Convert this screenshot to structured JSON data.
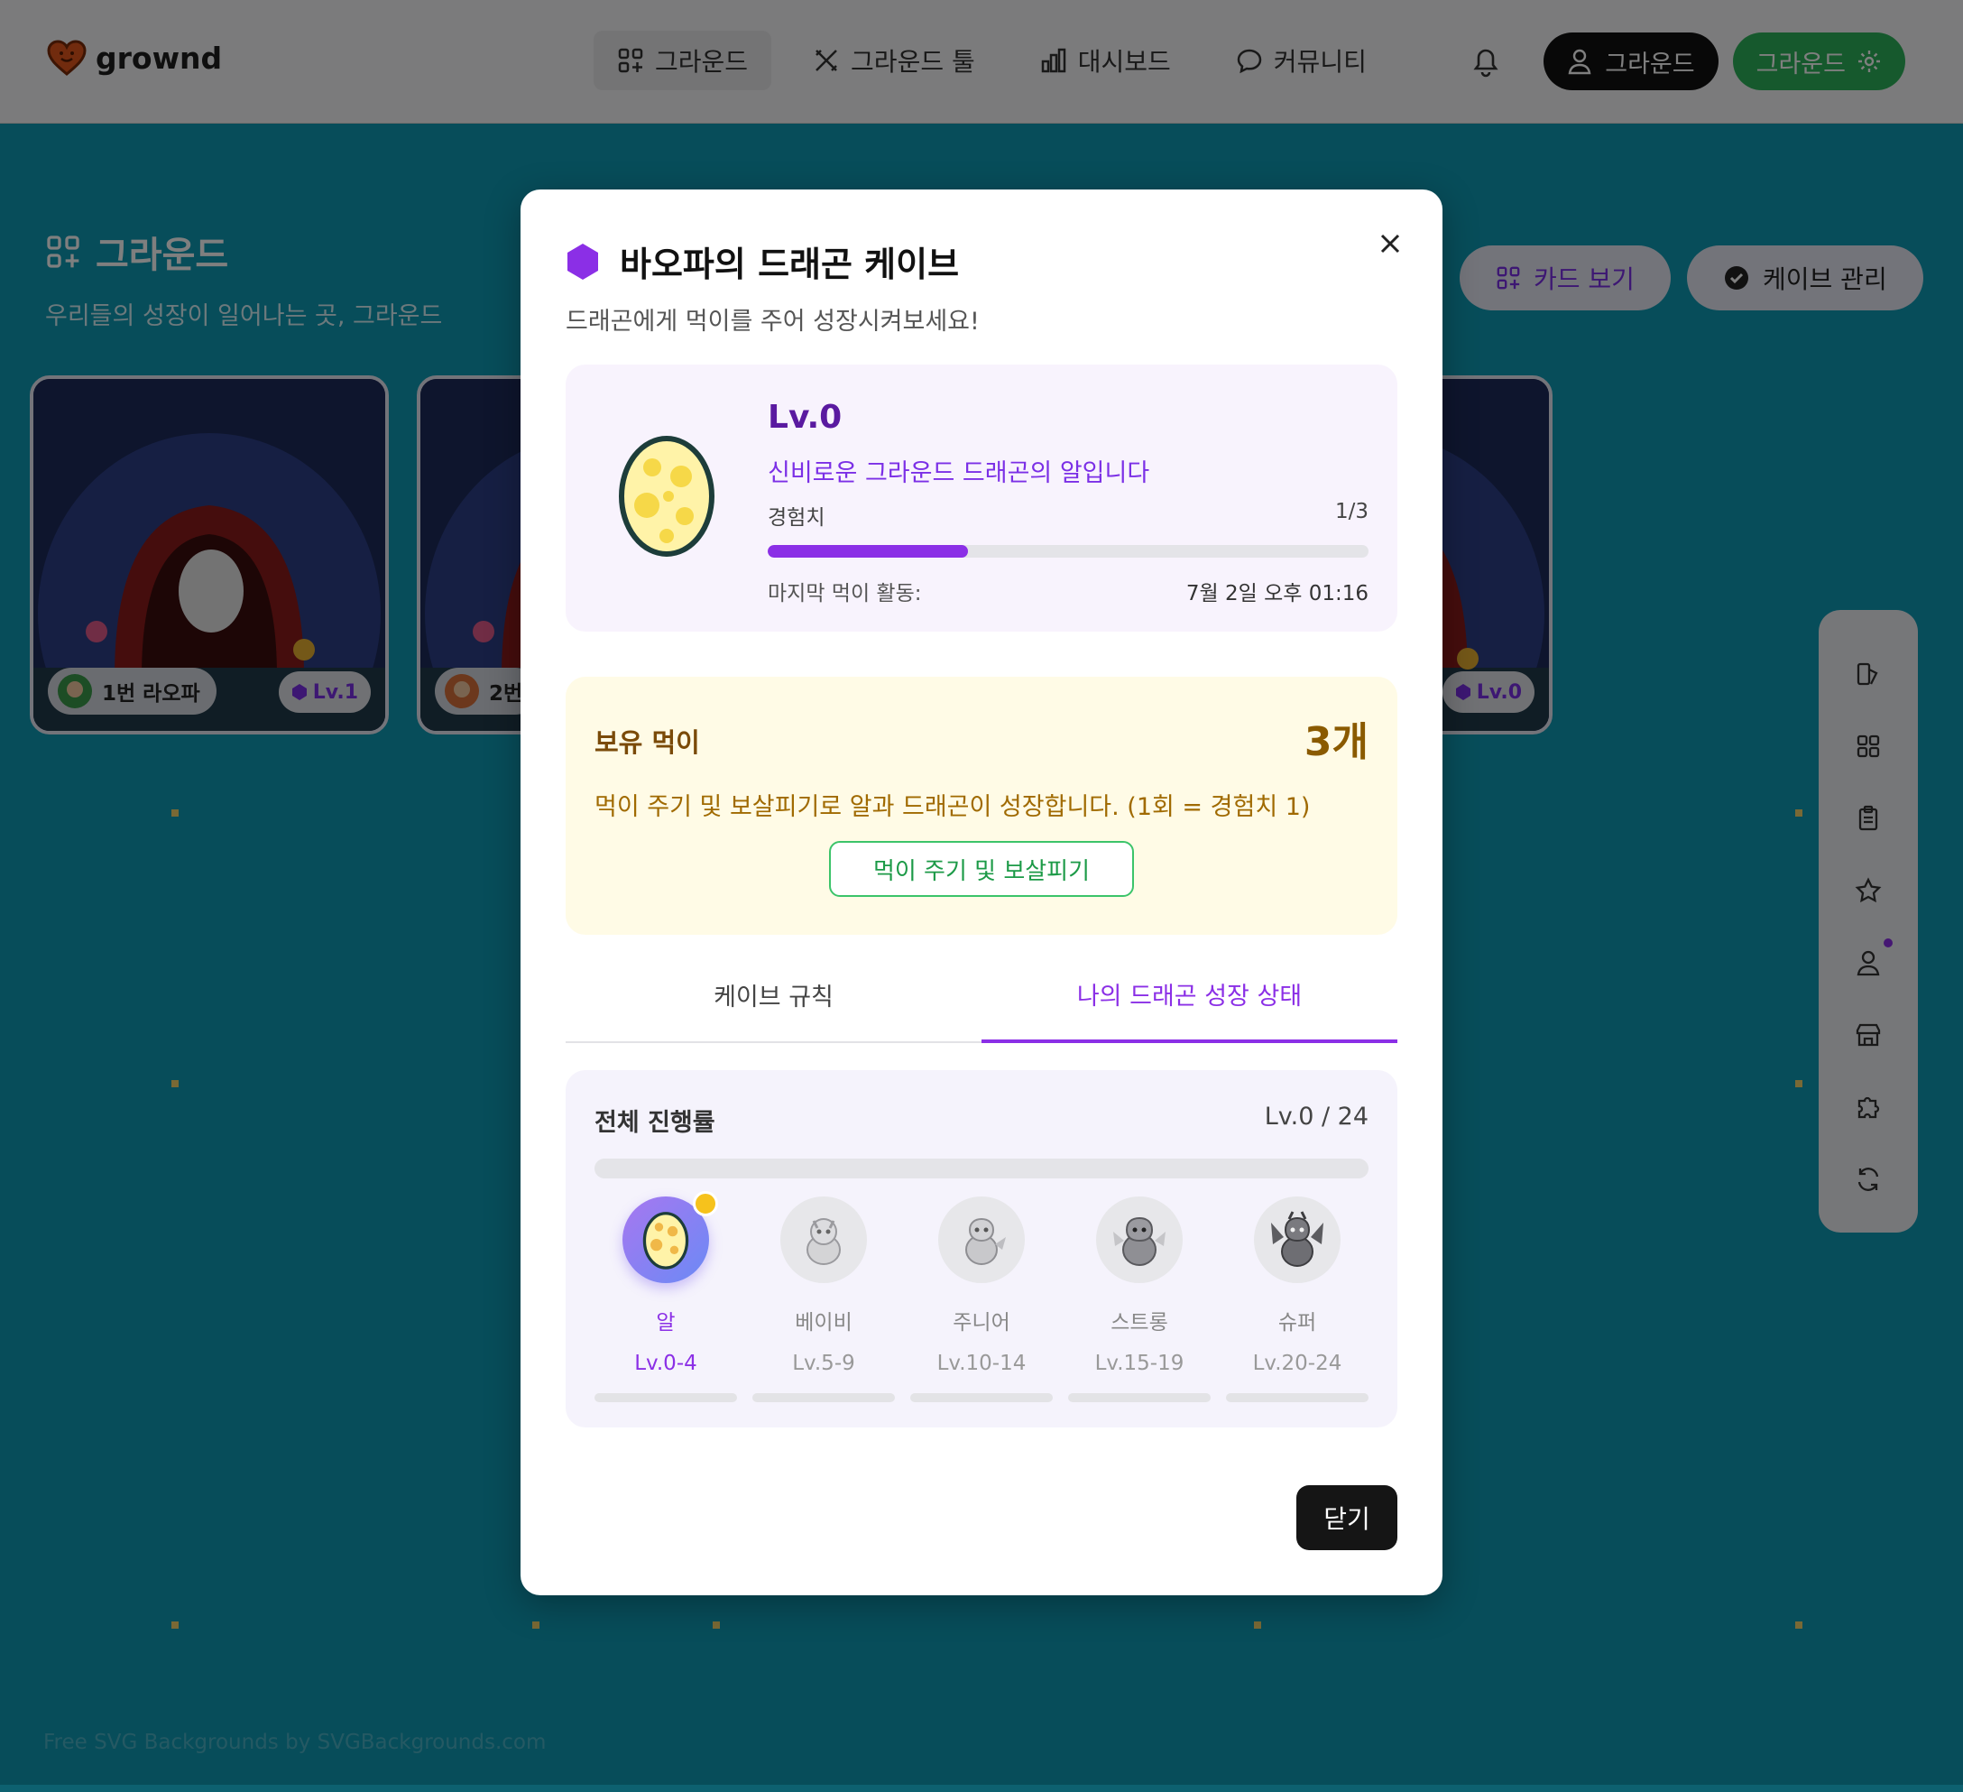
{
  "header": {
    "logo_text": "grownd",
    "nav": [
      {
        "label": "그라운드",
        "icon": "grid-plus-icon",
        "active": true
      },
      {
        "label": "그라운드 툴",
        "icon": "tools-icon",
        "active": false
      },
      {
        "label": "대시보드",
        "icon": "bar-chart-icon",
        "active": false
      },
      {
        "label": "커뮤니티",
        "icon": "chat-icon",
        "active": false
      }
    ],
    "account_label": "그라운드",
    "settings_label": "그라운드"
  },
  "page": {
    "title": "그라운드",
    "subtitle": "우리들의 성장이 일어나는 곳, 그라운드",
    "card_view_label": "카드 보기",
    "cave_manage_label": "케이브 관리",
    "cards": [
      {
        "name": "1번 라오파",
        "level": "Lv.1"
      },
      {
        "name": "2번",
        "level": ""
      },
      {
        "name": "",
        "level": "Lv.0"
      }
    ],
    "watermark": "Free SVG Backgrounds by SVGBackgrounds.com"
  },
  "modal": {
    "title": "바오파의 드래곤 케이브",
    "subtitle": "드래곤에게 먹이를 주어 성장시켜보세요!",
    "status": {
      "level": "Lv.0",
      "description": "신비로운 그라운드 드래곤의 알입니다",
      "exp_label": "경험치",
      "exp_value": "1/3",
      "exp_ratio": 0.333,
      "last_feed_label": "마지막 먹이 활동:",
      "last_feed_value": "7월 2일 오후 01:16"
    },
    "food": {
      "label": "보유 먹이",
      "count": "3개",
      "description": "먹이 주기 및 보살피기로 알과 드래곤이 성장합니다. (1회 = 경험치 1)",
      "button": "먹이 주기 및 보살피기"
    },
    "tabs": [
      {
        "label": "케이브 규칙",
        "active": false
      },
      {
        "label": "나의 드래곤 성장 상태",
        "active": true
      }
    ],
    "progress": {
      "label": "전체 진행률",
      "value": "Lv.0 / 24",
      "stages": [
        {
          "name": "알",
          "range": "Lv.0-4",
          "icon": "egg-icon",
          "active": true
        },
        {
          "name": "베이비",
          "range": "Lv.5-9",
          "icon": "baby-dragon-icon",
          "active": false
        },
        {
          "name": "주니어",
          "range": "Lv.10-14",
          "icon": "junior-dragon-icon",
          "active": false
        },
        {
          "name": "스트롱",
          "range": "Lv.15-19",
          "icon": "strong-dragon-icon",
          "active": false
        },
        {
          "name": "슈퍼",
          "range": "Lv.20-24",
          "icon": "super-dragon-icon",
          "active": false
        }
      ]
    },
    "close_label": "닫기"
  },
  "colors": {
    "accent_purple": "#8b2fe6",
    "accent_green": "#2db35a",
    "background_teal": "#0f9ab5"
  }
}
